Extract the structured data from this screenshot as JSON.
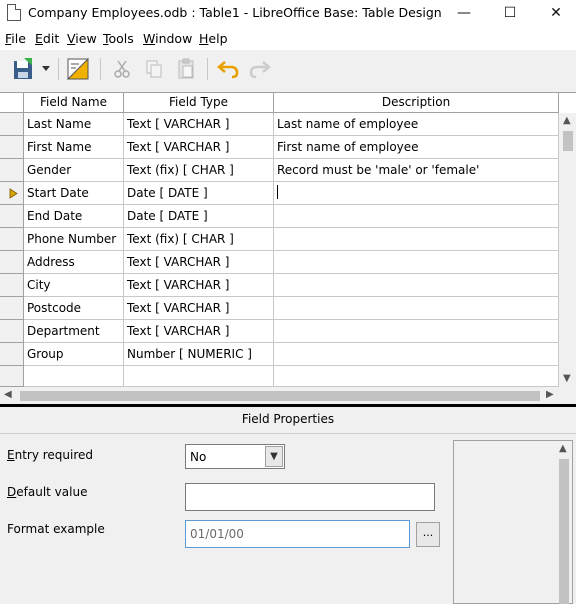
{
  "window": {
    "title": "Company Employees.odb : Table1 - LibreOffice Base: Table Design",
    "minimize": "—",
    "maximize": "☐",
    "close": "✕"
  },
  "menu": [
    {
      "label": "File",
      "mnemonic": "F",
      "rest": "ile"
    },
    {
      "label": "Edit",
      "mnemonic": "E",
      "rest": "dit"
    },
    {
      "label": "View",
      "mnemonic": "V",
      "rest": "iew"
    },
    {
      "label": "Tools",
      "mnemonic": "T",
      "rest": "ools"
    },
    {
      "label": "Window",
      "mnemonic": "W",
      "rest": "indow"
    },
    {
      "label": "Help",
      "mnemonic": "H",
      "rest": "elp"
    }
  ],
  "toolbar": {
    "icons": [
      "save-icon",
      "dropdown-arrow-icon",
      "index-design-icon",
      "cut-icon",
      "copy-icon",
      "paste-icon",
      "undo-icon",
      "redo-icon"
    ],
    "accent": "#f0b000"
  },
  "grid": {
    "headers": {
      "name": "Field Name",
      "type": "Field Type",
      "description": "Description"
    },
    "rows": [
      {
        "name": "Last Name",
        "type": "Text [ VARCHAR ]",
        "description": "Last name of employee"
      },
      {
        "name": "First Name",
        "type": "Text [ VARCHAR ]",
        "description": "First name of employee"
      },
      {
        "name": "Gender",
        "type": "Text (fix) [ CHAR ]",
        "description": "Record must be 'male' or 'female'"
      },
      {
        "name": "Start Date",
        "type": "Date [ DATE ]",
        "description": ""
      },
      {
        "name": "End Date",
        "type": "Date [ DATE ]",
        "description": ""
      },
      {
        "name": "Phone Number",
        "type": "Text (fix) [ CHAR ]",
        "description": ""
      },
      {
        "name": "Address",
        "type": "Text [ VARCHAR ]",
        "description": ""
      },
      {
        "name": "City",
        "type": "Text [ VARCHAR ]",
        "description": ""
      },
      {
        "name": "Postcode",
        "type": "Text [ VARCHAR ]",
        "description": ""
      },
      {
        "name": "Department",
        "type": "Text [ VARCHAR ]",
        "description": ""
      },
      {
        "name": "Group",
        "type": "Number [ NUMERIC ]",
        "description": ""
      },
      {
        "name": "",
        "type": "",
        "description": ""
      }
    ],
    "current_row_marker": "current-row-arrow-icon",
    "current_row_color": "#d9a400"
  },
  "properties": {
    "title": "Field Properties",
    "entry_required": {
      "label": "Entry required",
      "mnemonic": "E",
      "rest": "ntry required",
      "value": "No"
    },
    "default_value": {
      "label": "Default value",
      "mnemonic": "D",
      "rest": "efault value",
      "value": ""
    },
    "format_example": {
      "label": "Format example",
      "value": "01/01/00",
      "button": "..."
    }
  }
}
